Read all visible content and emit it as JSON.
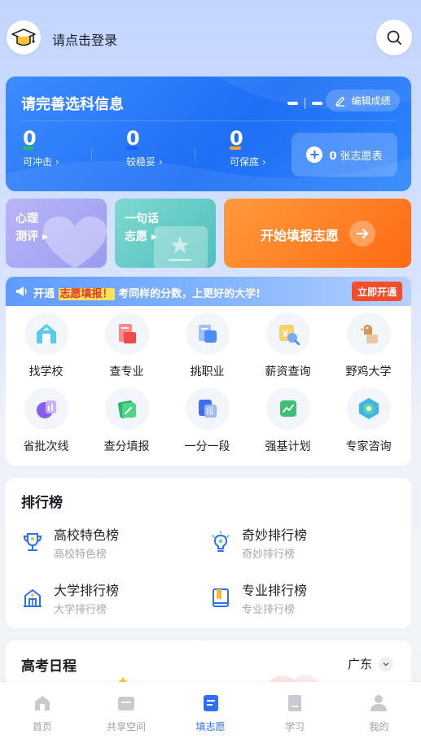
{
  "header": {
    "login_text": "请点击登录"
  },
  "info_card": {
    "title": "请完善选科信息",
    "edit_label": "编辑成绩",
    "stats": [
      {
        "value": "0",
        "label": "可冲击",
        "color": "#18c46b"
      },
      {
        "value": "0",
        "label": "较稳妥",
        "color": "#1561ff"
      },
      {
        "value": "0",
        "label": "可保底",
        "color": "#ffa31a"
      }
    ],
    "wish_count": "0",
    "wish_label": "张志愿表"
  },
  "tiles": {
    "psych": {
      "line1": "心理",
      "line2": "测评"
    },
    "saying": {
      "line1": "一句话",
      "line2": "志愿"
    },
    "start": {
      "label": "开始填报志愿"
    }
  },
  "banner": {
    "prefix": "开通",
    "highlight": "志愿填报！",
    "rest": "考同样的分数，上更好的大学!",
    "button": "立即开通"
  },
  "tools": [
    {
      "label": "找学校",
      "icon": "school-icon"
    },
    {
      "label": "查专业",
      "icon": "major-book-icon"
    },
    {
      "label": "挑职业",
      "icon": "career-icon"
    },
    {
      "label": "薪资查询",
      "icon": "salary-search-icon"
    },
    {
      "label": "野鸡大学",
      "icon": "fake-university-icon"
    },
    {
      "label": "省批次线",
      "icon": "batch-line-icon"
    },
    {
      "label": "查分填报",
      "icon": "score-fill-icon"
    },
    {
      "label": "一分一段",
      "icon": "score-segment-icon"
    },
    {
      "label": "强基计划",
      "icon": "strong-base-icon"
    },
    {
      "label": "专家咨询",
      "icon": "expert-consult-icon"
    }
  ],
  "ranking": {
    "title": "排行榜",
    "items": [
      {
        "title": "高校特色榜",
        "subtitle": "高校特色榜",
        "icon": "trophy-icon"
      },
      {
        "title": "奇妙排行榜",
        "subtitle": "奇妙排行榜",
        "icon": "lightbulb-icon"
      },
      {
        "title": "大学排行榜",
        "subtitle": "大学排行榜",
        "icon": "university-building-icon"
      },
      {
        "title": "专业排行榜",
        "subtitle": "专业排行榜",
        "icon": "book-icon"
      }
    ]
  },
  "schedule": {
    "title": "高考日程",
    "region": "广东"
  },
  "tabbar": [
    {
      "label": "首页",
      "icon": "home-icon",
      "active": false
    },
    {
      "label": "共享空间",
      "icon": "shared-space-icon",
      "active": false
    },
    {
      "label": "填志愿",
      "icon": "fill-wish-icon",
      "active": true
    },
    {
      "label": "学习",
      "icon": "study-icon",
      "active": false
    },
    {
      "label": "我的",
      "icon": "profile-icon",
      "active": false
    }
  ],
  "colors": {
    "primary": "#2d6ff7",
    "orange": "#ff6a12",
    "banner_button": "#f44d2a"
  }
}
